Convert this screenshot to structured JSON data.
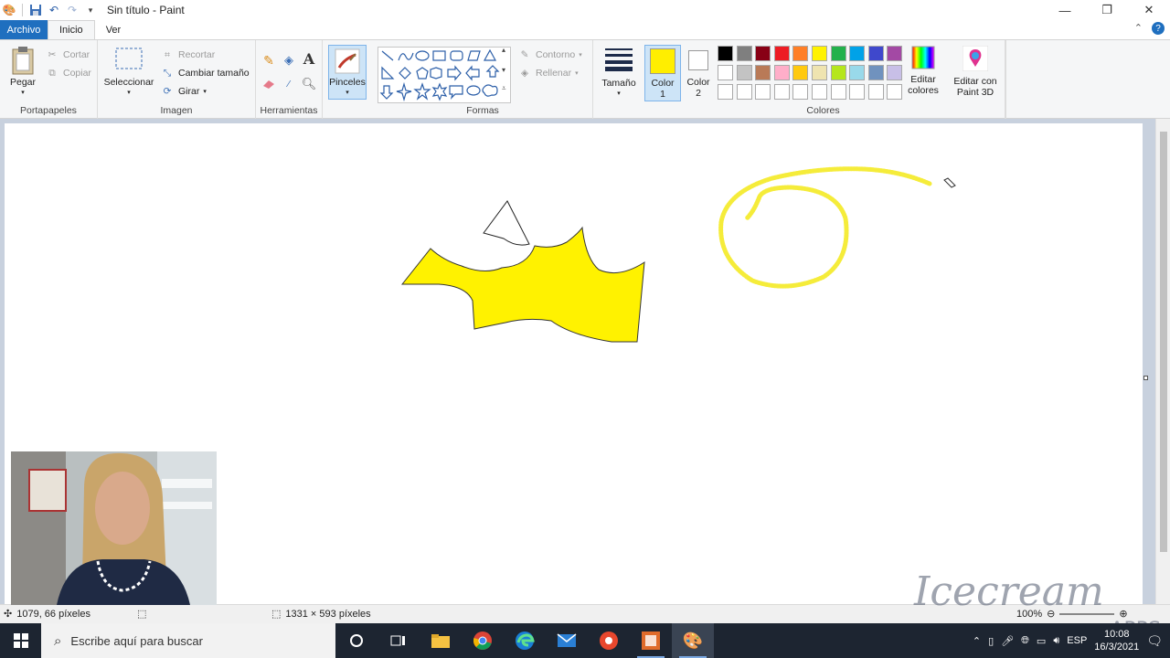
{
  "window": {
    "title": "Sin título - Paint",
    "controls": [
      "minimize-icon",
      "restore-icon",
      "close-icon"
    ]
  },
  "tabs": [
    {
      "label": "Archivo"
    },
    {
      "label": "Inicio"
    },
    {
      "label": "Ver"
    }
  ],
  "ribbon": {
    "portapapeles": {
      "label": "Portapapeles",
      "pegar": "Pegar",
      "cortar": "Cortar",
      "copiar": "Copiar"
    },
    "imagen": {
      "label": "Imagen",
      "seleccionar": "Seleccionar",
      "recortar": "Recortar",
      "cambiar": "Cambiar tamaño",
      "girar": "Girar"
    },
    "herramientas": {
      "label": "Herramientas"
    },
    "pinceles": {
      "label": "Pinceles"
    },
    "formas": {
      "label": "Formas",
      "contorno": "Contorno",
      "rellenar": "Rellenar"
    },
    "tamano": {
      "label": "Tamaño"
    },
    "color1": {
      "label": "Color",
      "num": "1",
      "value": "#ffee00"
    },
    "color2": {
      "label": "Color",
      "num": "2",
      "value": "#ffffff"
    },
    "colores": {
      "label": "Colores",
      "editar": "Editar colores"
    },
    "paint3d": {
      "label": "Editar con Paint 3D"
    }
  },
  "palette": {
    "row1": [
      "#000000",
      "#7f7f7f",
      "#880015",
      "#ed1c24",
      "#ff7f27",
      "#fff200",
      "#22b14c",
      "#00a2e8",
      "#3f48cc",
      "#a349a4"
    ],
    "row2": [
      "#ffffff",
      "#c3c3c3",
      "#b97a57",
      "#ffaec9",
      "#ffc90e",
      "#efe4b0",
      "#b5e61d",
      "#99d9ea",
      "#7092be",
      "#c8bfe7"
    ]
  },
  "status": {
    "cursor_pos": "1079, 66 píxeles",
    "canvas_size": "1331 × 593 píxeles",
    "zoom": "100%"
  },
  "taskbar": {
    "search_placeholder": "Escribe aquí para buscar",
    "lang": "ESP",
    "time": "10:08",
    "date": "16/3/2021"
  },
  "watermark": {
    "brand": "Icecream",
    "sub": "APPS"
  }
}
